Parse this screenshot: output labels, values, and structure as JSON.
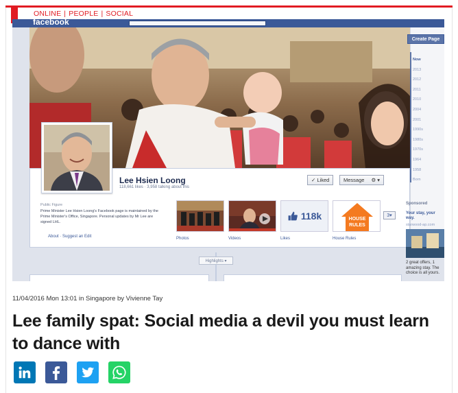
{
  "breadcrumb": {
    "items": [
      "ONLINE",
      "PEOPLE",
      "SOCIAL"
    ]
  },
  "facebook_screenshot": {
    "logo": "facebook",
    "create_page": "Create Page",
    "timeline_years": [
      "Now",
      "2013",
      "2012",
      "2011",
      "2010",
      "2004",
      "2001",
      "1990s",
      "1980s",
      "1970s",
      "1964",
      "1958",
      "Born"
    ],
    "page_name": "Lee Hsien Loong",
    "page_stats": "118,661 likes · 3,958 talking about this",
    "liked_button": "✓ Liked",
    "message_button": "Message",
    "category": "Public Figure",
    "description": "Prime Minister Lee Hsien Loong's Facebook page is maintained by the Prime Minister's Office, Singapore. Personal updates by Mr Lee are signed LHL.",
    "about_links": "About  ·  Suggest an Edit",
    "thumb_labels": [
      "Photos",
      "Videos",
      "Likes",
      "House Rules"
    ],
    "likes_count": "118k",
    "house_rules_text": [
      "HOUSE",
      "RULES"
    ],
    "more_button": "3▾",
    "highlights": "Highlights ▾",
    "sponsored": "Sponsored",
    "ad_title": "Your stay, your way.",
    "ad_url": "starwood-ap.com",
    "ad_text": "2 great offers, 1 amazing stay. The choice is all yours."
  },
  "article": {
    "meta": "11/04/2016 Mon 13:01 in Singapore by Vivienne Tay",
    "headline": "Lee family spat: Social media a devil you must learn to dance with"
  },
  "share": {
    "icons": [
      "linkedin-icon",
      "facebook-icon",
      "twitter-icon",
      "whatsapp-icon"
    ],
    "colors": {
      "linkedin": "#0077b5",
      "facebook": "#3b5998",
      "twitter": "#1da1f2",
      "whatsapp": "#25d366"
    }
  },
  "colors": {
    "accent_red": "#e11b22",
    "facebook_blue": "#3b5998"
  }
}
